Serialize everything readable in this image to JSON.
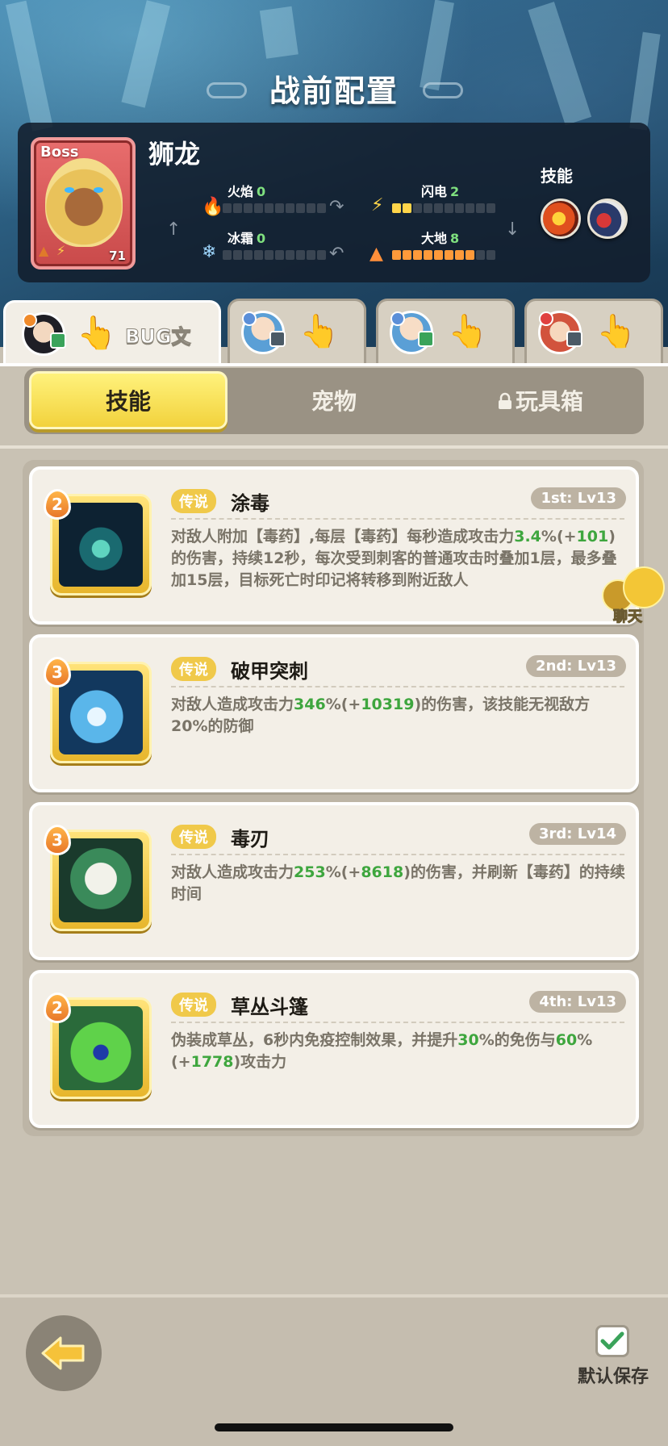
{
  "header": {
    "title": "战前配置"
  },
  "boss": {
    "tag": "Boss",
    "name": "狮龙",
    "level": "71",
    "elements": {
      "fire": {
        "label": "火焰",
        "value": "0",
        "fill": 0
      },
      "lightning": {
        "label": "闪电",
        "value": "2",
        "fill": 2
      },
      "frost": {
        "label": "冰霜",
        "value": "0",
        "fill": 0
      },
      "earth": {
        "label": "大地",
        "value": "8",
        "fill": 8
      }
    },
    "skills_label": "技能"
  },
  "hero_tabs": [
    {
      "name": "BUG文",
      "active": true
    },
    {
      "name": "",
      "active": false
    },
    {
      "name": "",
      "active": false
    },
    {
      "name": "",
      "active": false
    }
  ],
  "segments": {
    "skills": "技能",
    "pets": "宠物",
    "toybox": "玩具箱"
  },
  "skills": [
    {
      "level": "2",
      "rarity": "传说",
      "name": "涂毒",
      "slot": "1st: Lv13",
      "desc_parts": [
        "对敌人附加【毒药】,每层【毒药】每秒造成攻击力",
        "3.4",
        "%(+",
        "101",
        ")的伤害，持续12秒，每次受到刺客的普通攻击时叠加1层，最多叠加15层，目标死亡时印记将转移到附近敌人"
      ]
    },
    {
      "level": "3",
      "rarity": "传说",
      "name": "破甲突刺",
      "slot": "2nd: Lv13",
      "desc_parts": [
        "对敌人造成攻击力",
        "346",
        "%(+",
        "10319",
        ")的伤害，该技能无视敌方20%的防御"
      ]
    },
    {
      "level": "3",
      "rarity": "传说",
      "name": "毒刃",
      "slot": "3rd: Lv14",
      "desc_parts": [
        "对敌人造成攻击力",
        "253",
        "%(+",
        "8618",
        ")的伤害，并刷新【毒药】的持续时间"
      ]
    },
    {
      "level": "2",
      "rarity": "传说",
      "name": "草丛斗篷",
      "slot": "4th: Lv13",
      "desc_parts": [
        "伪装成草丛，6秒内免疫控制效果，并提升",
        "30",
        "%的免伤与",
        "60",
        "%(+",
        "1778",
        ")攻击力"
      ]
    }
  ],
  "chat": {
    "label": "聊天"
  },
  "footer": {
    "save_label": "默认保存"
  },
  "colors": {
    "accent_yellow": "#f2d23c",
    "green_value": "#3ea63e",
    "rarity": "#f0c94a"
  }
}
